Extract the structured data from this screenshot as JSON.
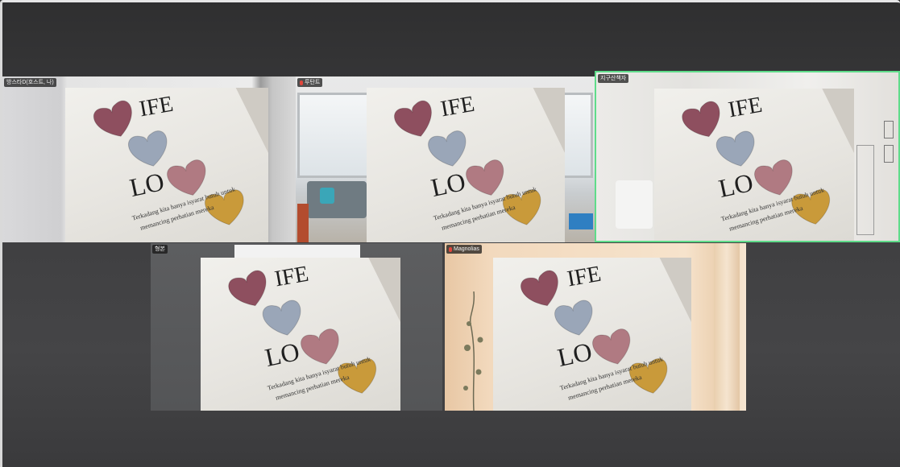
{
  "participants": [
    {
      "name": "방스타D(호스트, 나)",
      "mic_muted": false,
      "active": false
    },
    {
      "name": "루탄트",
      "mic_muted": true,
      "active": false
    },
    {
      "name": "지구산책자",
      "mic_muted": false,
      "active": true
    },
    {
      "name": "형본",
      "mic_muted": false,
      "active": false
    },
    {
      "name": "Magnolias",
      "mic_muted": true,
      "active": false
    }
  ],
  "poster": {
    "word_top": "IFE",
    "word_bottom": "LO",
    "caption_line1": "Terkadang kita hanya isyarat butuh untuk",
    "caption_line2": "memancing perhatian mereka"
  },
  "colors": {
    "active_border": "#5fdc8a",
    "heart_plum": "#8e4f5f",
    "heart_blue": "#9aa6b8",
    "heart_rose": "#b07a82",
    "heart_gold": "#c99a3a"
  }
}
